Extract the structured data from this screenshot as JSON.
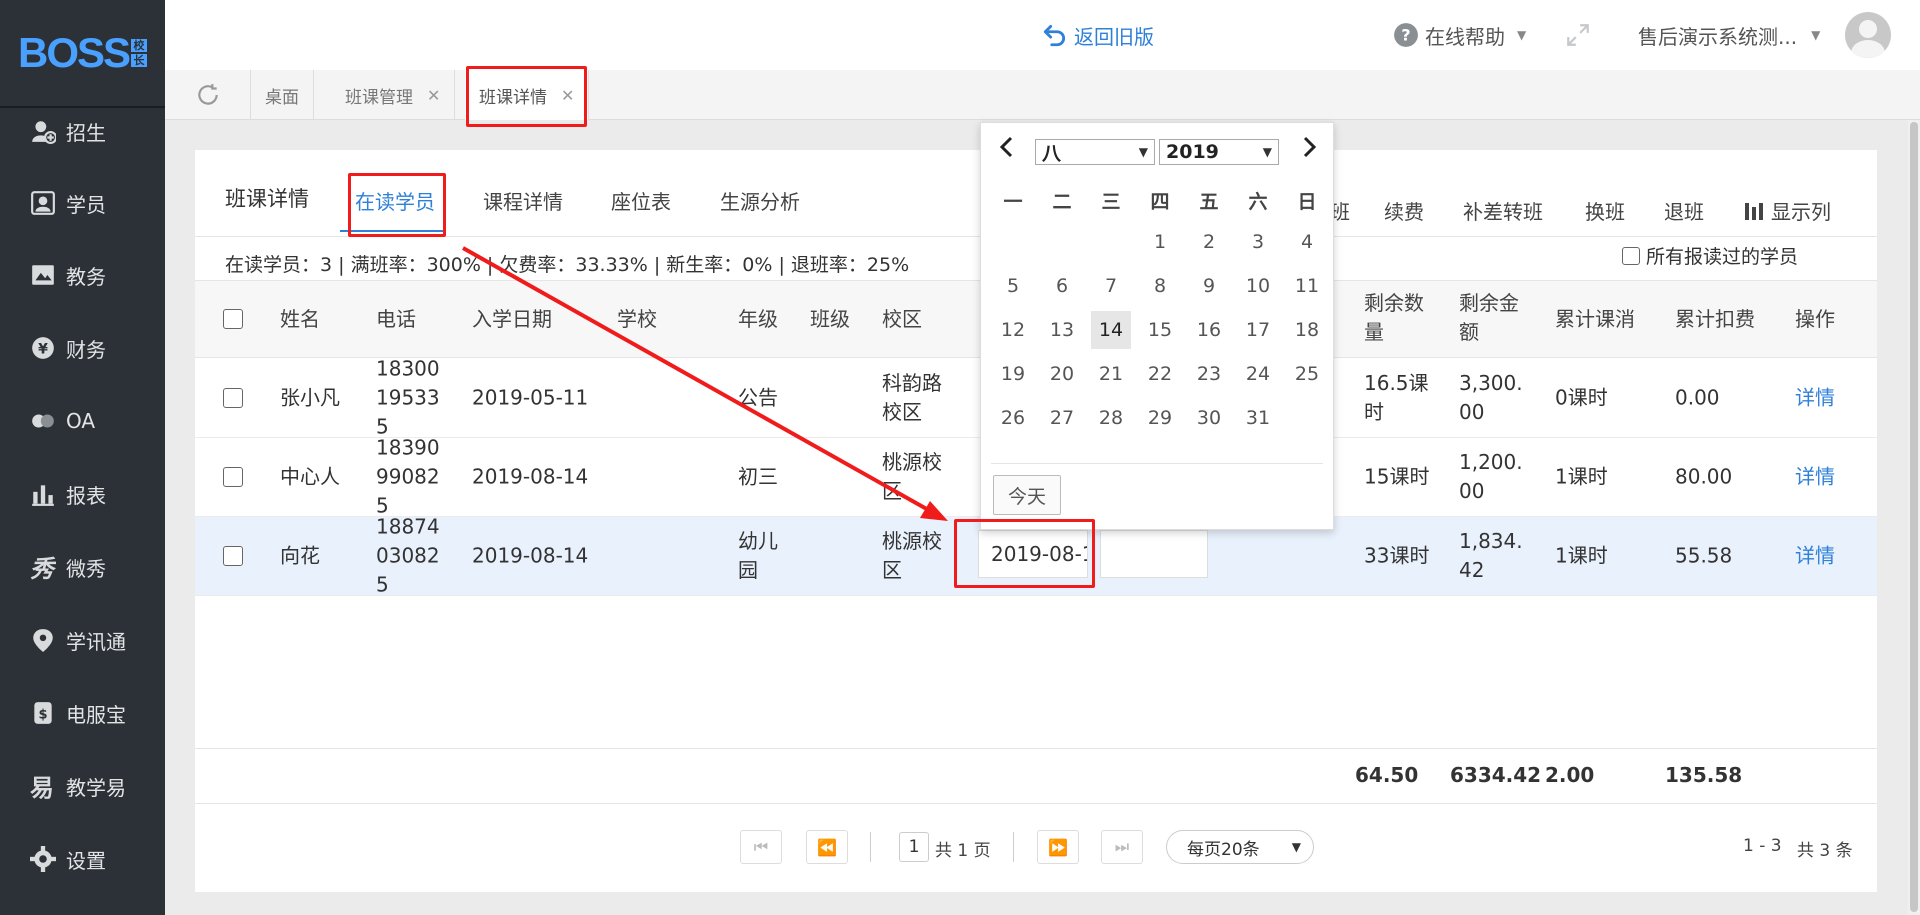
{
  "sidebar": {
    "logo_text": "BOSS",
    "logo_sub": [
      "校",
      "长"
    ],
    "items": [
      {
        "label": "招生",
        "icon": "enroll-icon"
      },
      {
        "label": "学员",
        "icon": "student-icon"
      },
      {
        "label": "教务",
        "icon": "academic-icon"
      },
      {
        "label": "财务",
        "icon": "finance-icon"
      },
      {
        "label": "OA",
        "icon": "oa-icon"
      },
      {
        "label": "报表",
        "icon": "report-icon"
      },
      {
        "label": "微秀",
        "icon": "weixiu-icon"
      },
      {
        "label": "学讯通",
        "icon": "xuexuntong-icon"
      },
      {
        "label": "电服宝",
        "icon": "dianfubao-icon"
      },
      {
        "label": "教学易",
        "icon": "jiaoxueyi-icon"
      },
      {
        "label": "设置",
        "icon": "gear-icon"
      }
    ]
  },
  "header": {
    "back_old": "返回旧版",
    "help": "在线帮助",
    "user": "售后演示系统测..."
  },
  "tabs": [
    {
      "label": "桌面",
      "closable": false
    },
    {
      "label": "班课管理",
      "closable": true
    },
    {
      "label": "班课详情",
      "closable": true
    }
  ],
  "page": {
    "title": "班课详情",
    "subtabs": [
      "在读学员",
      "课程详情",
      "座位表",
      "生源分析"
    ],
    "stats": "在读学员：3 | 满班率：300% | 欠费率：33.33% | 新生率：0% | 退班率：25%",
    "right_actions": [
      "班",
      "续费",
      "补差转班",
      "换班",
      "退班"
    ],
    "show_columns": "显示列",
    "all_students_label": "所有报读过的学员"
  },
  "table": {
    "headers": [
      "姓名",
      "电话",
      "入学日期",
      "学校",
      "年级",
      "班级",
      "校区",
      "剩余数量",
      "剩余金额",
      "累计课消",
      "累计扣费",
      "操作"
    ],
    "rows": [
      {
        "name": "张小凡",
        "phone": "18300195335",
        "date": "2019-05-11",
        "school": "",
        "grade": "公告",
        "class": "",
        "campus": "科韵路校区",
        "remaining_qty": "16.5课时",
        "remaining_amt": "3,300.00",
        "consumed": "0课时",
        "deducted": "0.00",
        "action": "详情"
      },
      {
        "name": "中心人",
        "phone": "18390990825",
        "date": "2019-08-14",
        "school": "",
        "grade": "初三",
        "class": "",
        "campus": "桃源校区",
        "remaining_qty": "15课时",
        "remaining_amt": "1,200.00",
        "consumed": "1课时",
        "deducted": "80.00",
        "action": "详情"
      },
      {
        "name": "向花",
        "phone": "18874030825",
        "date": "2019-08-14",
        "school": "",
        "grade": "幼儿园",
        "class": "",
        "campus": "桃源校区",
        "remaining_qty": "33课时",
        "remaining_amt": "1,834.42",
        "consumed": "1课时",
        "deducted": "55.58",
        "action": "详情"
      }
    ],
    "totals": {
      "qty": "64.50",
      "amt": "6334.42",
      "consumed": "2.00",
      "deducted": "135.58"
    }
  },
  "pagination": {
    "page": "1",
    "total_pages": "共 1 页",
    "per_page": "每页20条",
    "range": "1 - 3",
    "total": "共 3 条"
  },
  "calendar": {
    "month": "八",
    "year": "2019",
    "weekdays": [
      "一",
      "二",
      "三",
      "四",
      "五",
      "六",
      "日"
    ],
    "first_weekday_index": 3,
    "days_in_month": 31,
    "selected_day": 14,
    "today_label": "今天",
    "input_value": "2019-08-1"
  },
  "colors": {
    "accent": "#2f80d8",
    "sidebar_bg": "#2b3137",
    "highlight_row": "#e8f1fc",
    "annotation_red": "#f01b1b"
  }
}
